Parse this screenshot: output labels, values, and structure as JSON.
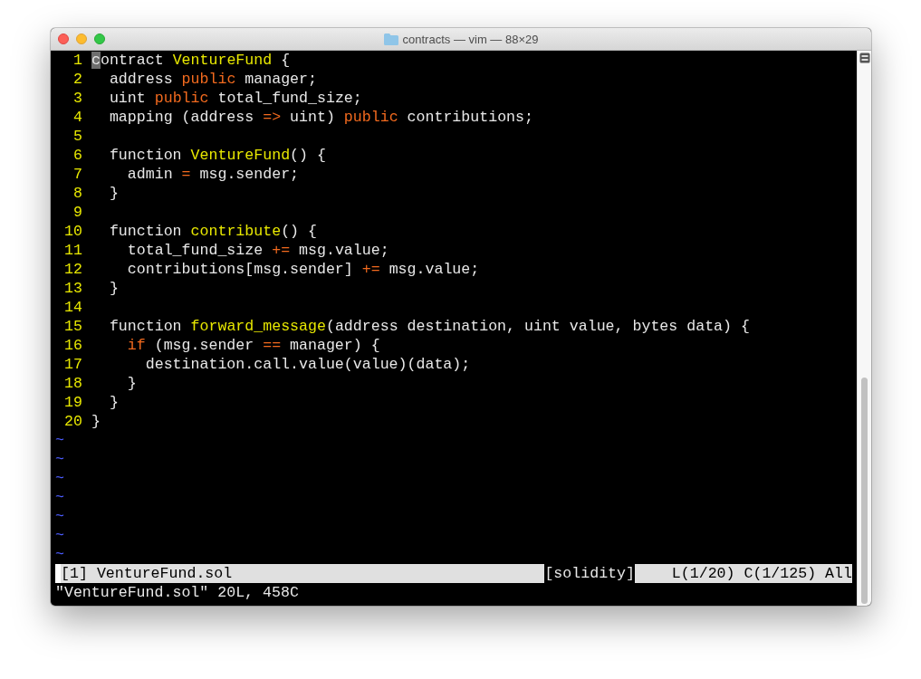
{
  "window": {
    "title": "contracts — vim — 88×29"
  },
  "editor": {
    "lines": [
      {
        "number": "1",
        "segments": [
          {
            "kind": "cursor",
            "text": "c"
          },
          {
            "kind": "plain",
            "text": "ontract "
          },
          {
            "kind": "function",
            "text": "VentureFund"
          },
          {
            "kind": "plain",
            "text": " {"
          }
        ]
      },
      {
        "number": "2",
        "segments": [
          {
            "kind": "plain",
            "text": "  address "
          },
          {
            "kind": "keyword",
            "text": "public"
          },
          {
            "kind": "plain",
            "text": " manager;"
          }
        ]
      },
      {
        "number": "3",
        "segments": [
          {
            "kind": "plain",
            "text": "  uint "
          },
          {
            "kind": "keyword",
            "text": "public"
          },
          {
            "kind": "plain",
            "text": " total_fund_size;"
          }
        ]
      },
      {
        "number": "4",
        "segments": [
          {
            "kind": "plain",
            "text": "  mapping (address "
          },
          {
            "kind": "keyword",
            "text": "=>"
          },
          {
            "kind": "plain",
            "text": " uint) "
          },
          {
            "kind": "keyword",
            "text": "public"
          },
          {
            "kind": "plain",
            "text": " contributions;"
          }
        ]
      },
      {
        "number": "5"
      },
      {
        "number": "6",
        "segments": [
          {
            "kind": "plain",
            "text": "  function "
          },
          {
            "kind": "function",
            "text": "VentureFund"
          },
          {
            "kind": "plain",
            "text": "() {"
          }
        ]
      },
      {
        "number": "7",
        "segments": [
          {
            "kind": "plain",
            "text": "    admin "
          },
          {
            "kind": "keyword",
            "text": "="
          },
          {
            "kind": "plain",
            "text": " msg.sender;"
          }
        ]
      },
      {
        "number": "8",
        "segments": [
          {
            "kind": "plain",
            "text": "  }"
          }
        ]
      },
      {
        "number": "9"
      },
      {
        "number": "10",
        "segments": [
          {
            "kind": "plain",
            "text": "  function "
          },
          {
            "kind": "function",
            "text": "contribute"
          },
          {
            "kind": "plain",
            "text": "() {"
          }
        ]
      },
      {
        "number": "11",
        "segments": [
          {
            "kind": "plain",
            "text": "    total_fund_size "
          },
          {
            "kind": "keyword",
            "text": "+="
          },
          {
            "kind": "plain",
            "text": " msg.value;"
          }
        ]
      },
      {
        "number": "12",
        "segments": [
          {
            "kind": "plain",
            "text": "    contributions[msg.sender] "
          },
          {
            "kind": "keyword",
            "text": "+="
          },
          {
            "kind": "plain",
            "text": " msg.value;"
          }
        ]
      },
      {
        "number": "13",
        "segments": [
          {
            "kind": "plain",
            "text": "  }"
          }
        ]
      },
      {
        "number": "14"
      },
      {
        "number": "15",
        "segments": [
          {
            "kind": "plain",
            "text": "  function "
          },
          {
            "kind": "function",
            "text": "forward_message"
          },
          {
            "kind": "plain",
            "text": "(address destination, uint value, bytes data) {"
          }
        ]
      },
      {
        "number": "16",
        "segments": [
          {
            "kind": "keyword",
            "text": "    if"
          },
          {
            "kind": "plain",
            "text": " (msg.sender "
          },
          {
            "kind": "keyword",
            "text": "=="
          },
          {
            "kind": "plain",
            "text": " manager) {"
          }
        ]
      },
      {
        "number": "17",
        "segments": [
          {
            "kind": "plain",
            "text": "      destination.call.value(value)(data);"
          }
        ]
      },
      {
        "number": "18",
        "segments": [
          {
            "kind": "plain",
            "text": "    }"
          }
        ]
      },
      {
        "number": "19",
        "segments": [
          {
            "kind": "plain",
            "text": "  }"
          }
        ]
      },
      {
        "number": "20",
        "segments": [
          {
            "kind": "plain",
            "text": "}"
          }
        ]
      }
    ],
    "filler": [
      "~",
      "~",
      "~",
      "~",
      "~",
      "~",
      "~"
    ]
  },
  "status_line": {
    "buffer": "[1]",
    "file": "VentureFund.sol",
    "filetype": "[solidity]",
    "position": "L(1/20) C(1/125) All"
  },
  "message": "\"VentureFund.sol\" 20L, 458C"
}
